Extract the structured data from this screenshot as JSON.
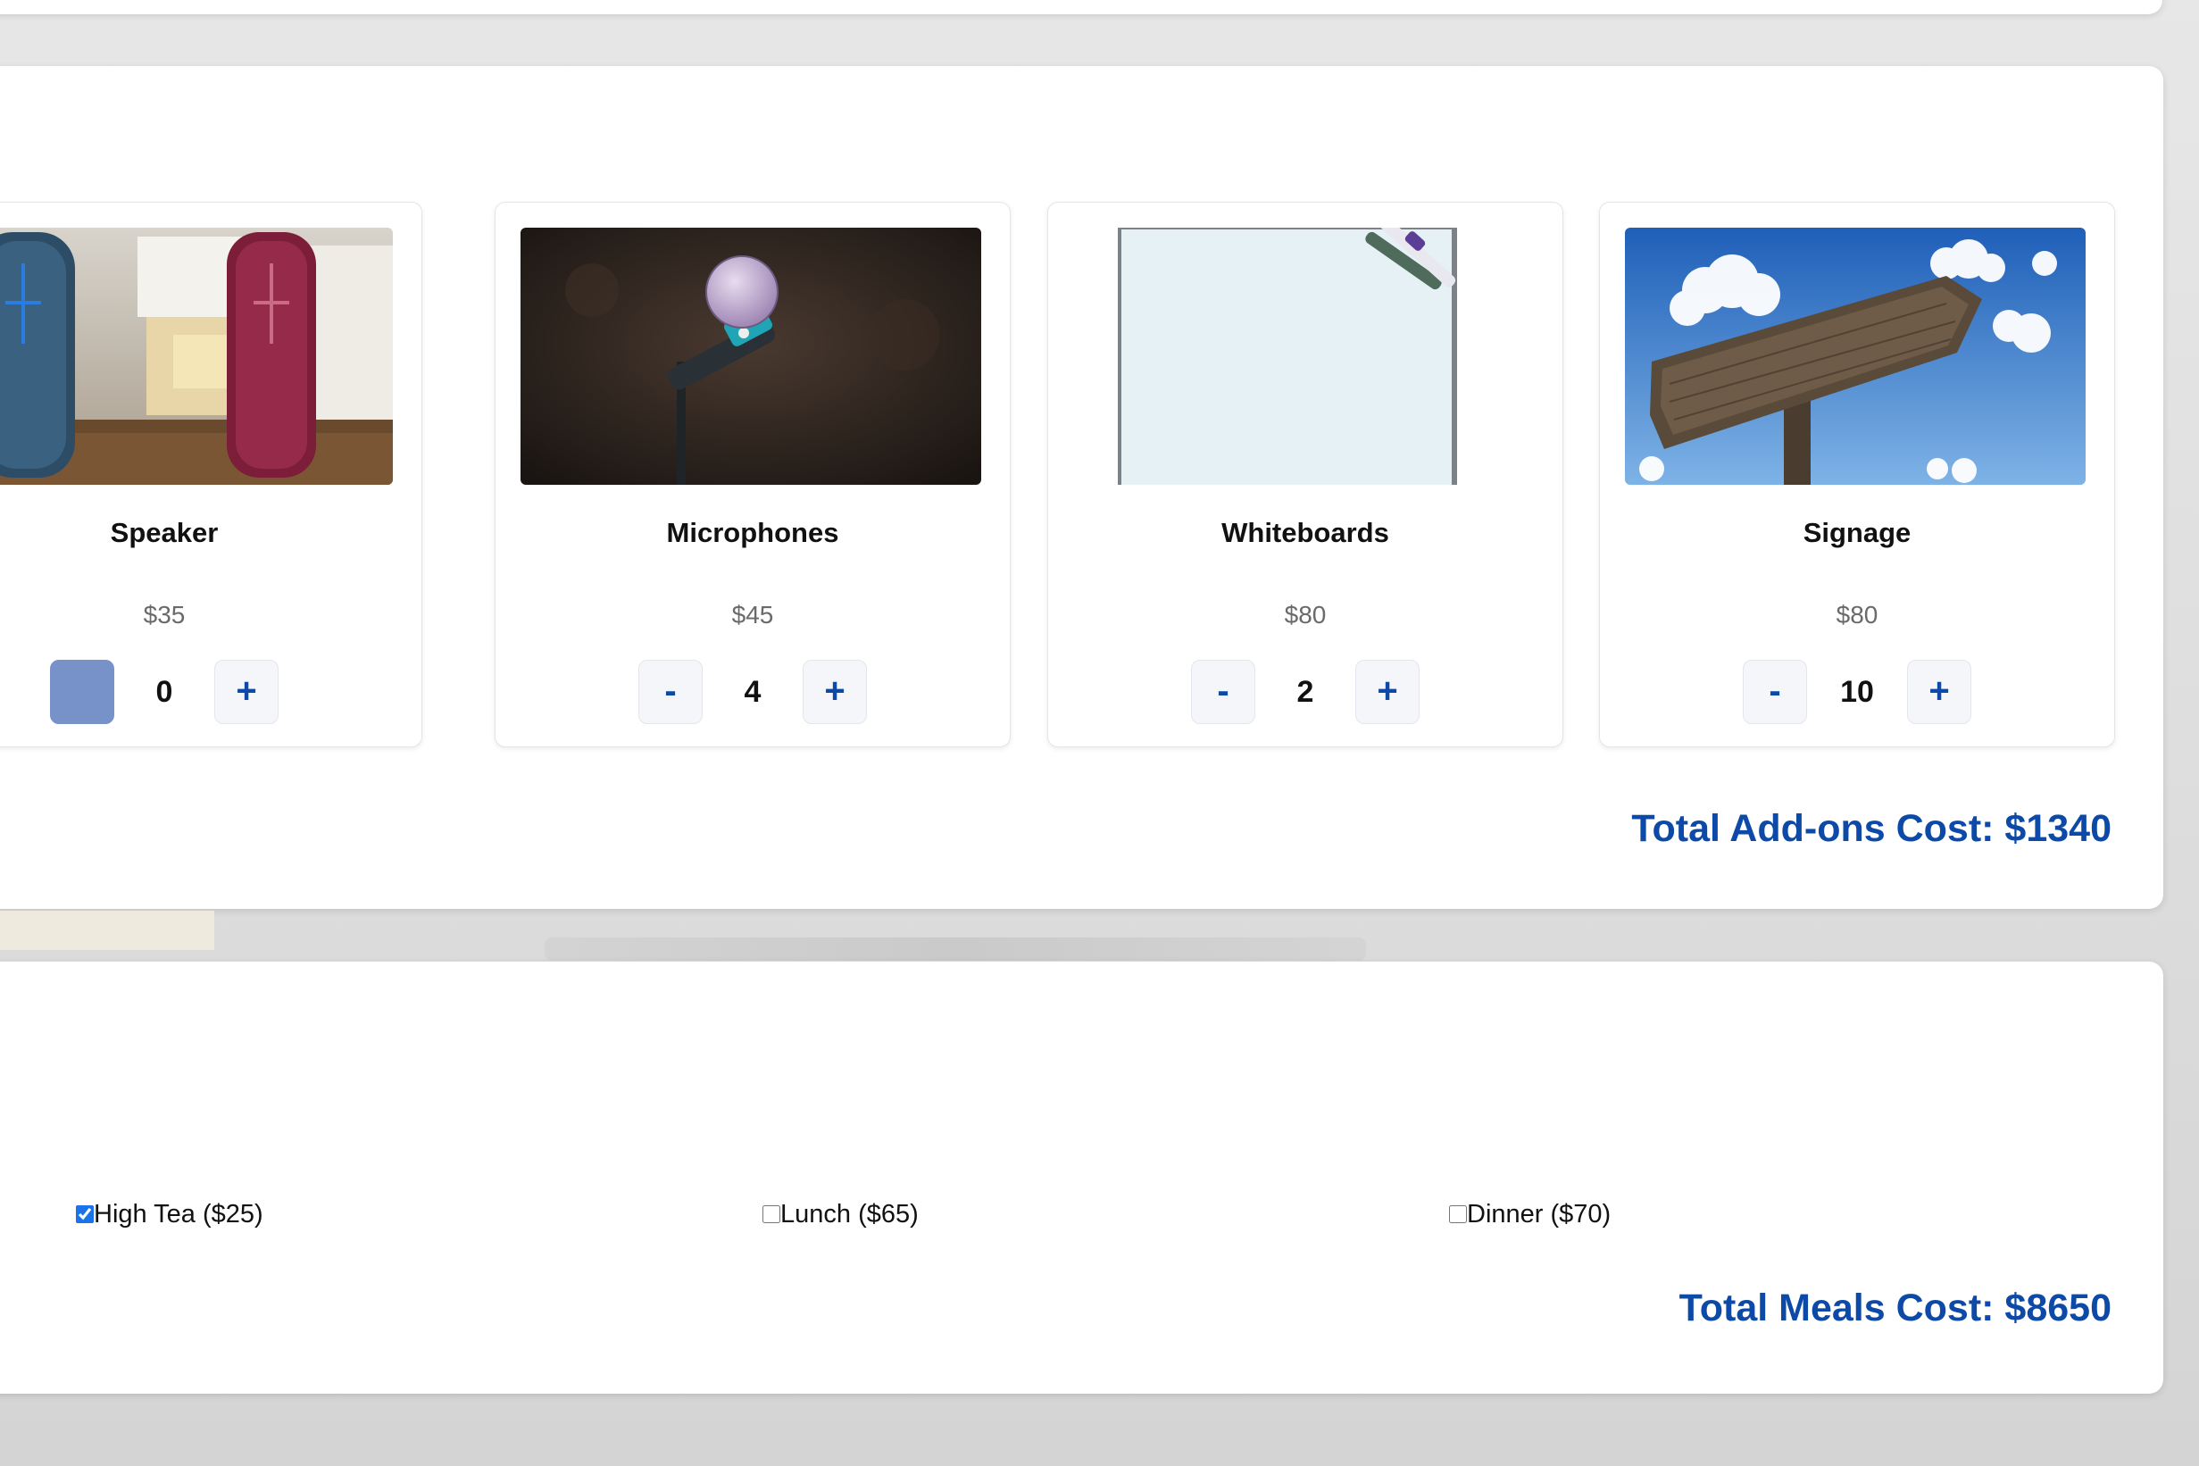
{
  "addons": {
    "items": [
      {
        "name": "Speaker",
        "price": "$35",
        "quantity": "0",
        "minus_label": "-",
        "plus_label": "+"
      },
      {
        "name": "Microphones",
        "price": "$45",
        "quantity": "4",
        "minus_label": "-",
        "plus_label": "+"
      },
      {
        "name": "Whiteboards",
        "price": "$80",
        "quantity": "2",
        "minus_label": "-",
        "plus_label": "+"
      },
      {
        "name": "Signage",
        "price": "$80",
        "quantity": "10",
        "minus_label": "-",
        "plus_label": "+"
      }
    ],
    "total_label": "Total Add-ons Cost: $1340"
  },
  "meals": {
    "options": [
      {
        "label": "High Tea ($25)",
        "checked": true
      },
      {
        "label": "Lunch ($65)",
        "checked": false
      },
      {
        "label": "Dinner ($70)",
        "checked": false
      }
    ],
    "total_label": "Total Meals Cost: $8650"
  },
  "colors": {
    "accent": "#0d4aa8",
    "disabled_button": "#7692c9",
    "price_text": "#6a6a6a"
  },
  "icons": [
    "minus-icon",
    "plus-icon"
  ]
}
